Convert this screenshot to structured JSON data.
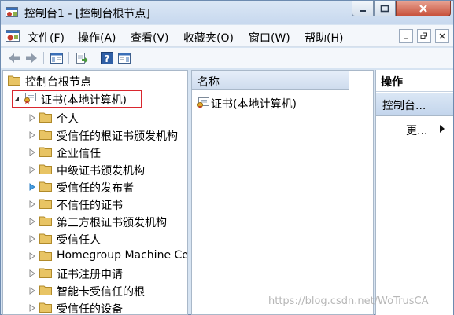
{
  "window": {
    "title": "控制台1 - [控制台根节点]"
  },
  "menu": {
    "items": [
      "文件(F)",
      "操作(A)",
      "查看(V)",
      "收藏夹(O)",
      "窗口(W)",
      "帮助(H)"
    ]
  },
  "tree": {
    "root": "控制台根节点",
    "cert_node": "证书(本地计算机)",
    "children": [
      "个人",
      "受信任的根证书颁发机构",
      "企业信任",
      "中级证书颁发机构",
      "受信任的发布者",
      "不信任的证书",
      "第三方根证书颁发机构",
      "受信任人",
      "Homegroup Machine Certificates",
      "证书注册申请",
      "智能卡受信任的根",
      "受信任的设备"
    ]
  },
  "list": {
    "column_name": "名称",
    "item": "证书(本地计算机)"
  },
  "actions": {
    "header": "操作",
    "section": "控制台...",
    "more": "更..."
  },
  "watermark": "https://blog.csdn.net/WoTrusCA",
  "colors": {
    "selection_border": "#d9272e",
    "folder": "#e8c464",
    "title_gradient_top": "#dbe7f5"
  }
}
